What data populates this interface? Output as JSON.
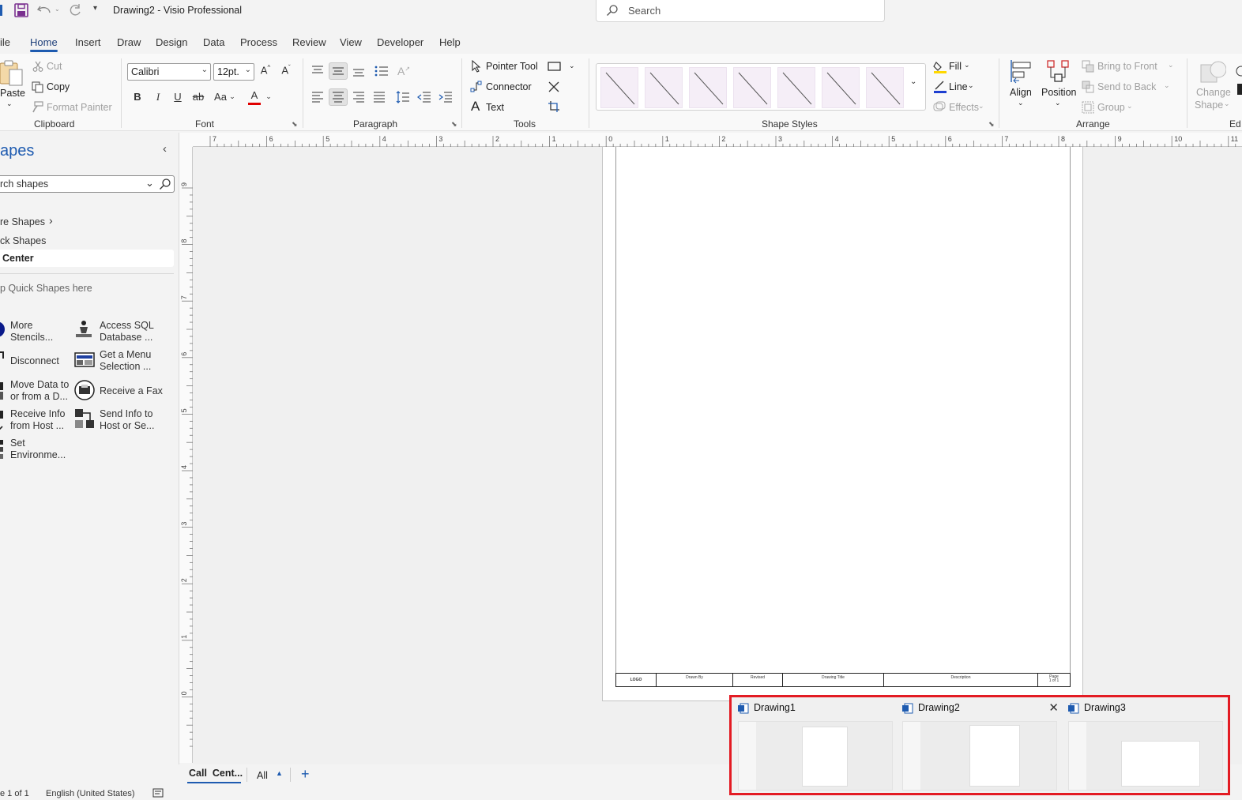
{
  "title_bar": {
    "title": "Drawing2  -  Visio Professional",
    "search_placeholder": "Search"
  },
  "tabs": [
    "ile",
    "Home",
    "Insert",
    "Draw",
    "Design",
    "Data",
    "Process",
    "Review",
    "View",
    "Developer",
    "Help"
  ],
  "active_tab": "Home",
  "ribbon": {
    "clipboard": {
      "paste": "Paste",
      "cut": "Cut",
      "copy": "Copy",
      "format_painter": "Format Painter",
      "label": "Clipboard"
    },
    "font": {
      "family": "Calibri",
      "size": "12pt.",
      "case_label": "Aa",
      "label": "Font",
      "bold": "B",
      "italic": "I",
      "underline": "U",
      "strike": "ab",
      "font_color": "A"
    },
    "paragraph": {
      "label": "Paragraph"
    },
    "tools": {
      "pointer": "Pointer Tool",
      "connector": "Connector",
      "text": "Text",
      "label": "Tools"
    },
    "shape_styles": {
      "label": "Shape Styles",
      "fill": "Fill",
      "line": "Line",
      "effects": "Effects"
    },
    "arrange": {
      "align": "Align",
      "position": "Position",
      "bring_front": "Bring to Front",
      "send_back": "Send to Back",
      "group": "Group",
      "label": "Arrange"
    },
    "change_shape": {
      "line1": "Change",
      "line2": "Shape",
      "edit_label": "Ed"
    }
  },
  "shapes_pane": {
    "title": "apes",
    "search_placeholder": "rch shapes",
    "more_shapes": "re Shapes",
    "quick_shapes": "ck Shapes",
    "selected_stencil": "Center",
    "drop_hint": "p Quick Shapes here",
    "shapes": [
      {
        "label": "More\nStencils..."
      },
      {
        "label": "Access SQL\nDatabase ..."
      },
      {
        "label": "Disconnect"
      },
      {
        "label": "Get a Menu\nSelection ..."
      },
      {
        "label": "Move Data to\nor from a D..."
      },
      {
        "label": "Receive a Fax"
      },
      {
        "label": "Receive Info\nfrom Host ..."
      },
      {
        "label": "Send Info to\nHost or Se..."
      },
      {
        "label": "Set\nEnvironme..."
      }
    ]
  },
  "rulers": {
    "horizontal_ticks": [
      "7",
      "6",
      "5",
      "4",
      "3",
      "2",
      "1",
      "0",
      "1",
      "2",
      "3",
      "4",
      "5",
      "6",
      "7",
      "8",
      "9",
      "10",
      "11"
    ],
    "vertical_ticks": [
      "9",
      "8",
      "7",
      "6",
      "5",
      "4",
      "3",
      "2",
      "1",
      "0"
    ]
  },
  "title_block": {
    "cells": [
      "LOGO",
      "Drawn By",
      "Revised",
      "Drawing Title",
      "Description",
      "Page\n1 of 1"
    ]
  },
  "page_tabs": {
    "current": "Call  Cent...",
    "all": "All",
    "add": "+"
  },
  "status_bar": {
    "page": "e 1 of 1",
    "language": "English (United States)"
  },
  "taskbar_preview": {
    "windows": [
      {
        "name": "Drawing1"
      },
      {
        "name": "Drawing2"
      },
      {
        "name": "Drawing3"
      }
    ],
    "close_glyph": "✕"
  },
  "colors": {
    "accent": "#1e5bb0",
    "highlight_border": "#e31b23",
    "font_color_bar": "#e00000"
  }
}
